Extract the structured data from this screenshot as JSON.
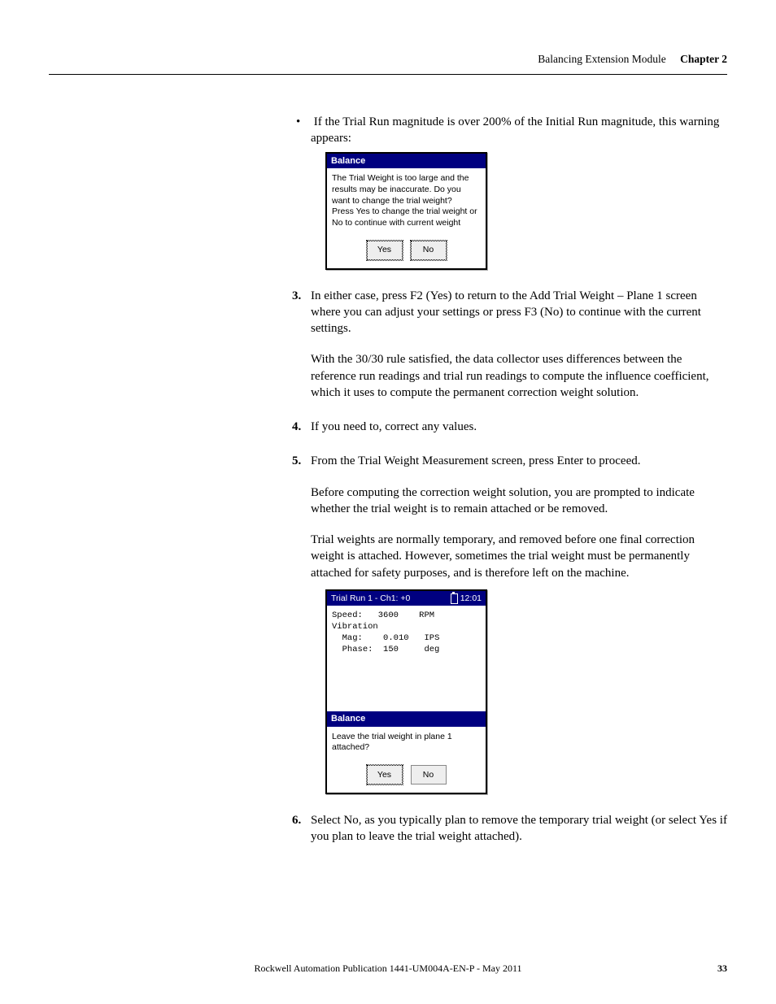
{
  "header": {
    "section_title": "Balancing Extension Module",
    "chapter_label": "Chapter 2"
  },
  "bullet1": "If the Trial Run magnitude is over 200% of the Initial Run magnitude, this warning appears:",
  "dialog1": {
    "title": "Balance",
    "body": "The Trial Weight is too large and the results may be inaccurate. Do you want to change the trial weight?\nPress Yes to change the trial weight or No to continue with current weight",
    "btn_yes": "Yes",
    "btn_no": "No"
  },
  "step3_num": "3.",
  "step3": "In either case, press F2 (Yes) to return to the Add Trial Weight – Plane 1 screen where you can adjust your settings or press F3 (No) to continue with the current settings.",
  "para3a": "With the 30/30 rule satisfied, the data collector uses differences between the reference run readings and trial run readings to compute the influence coefficient, which it uses to compute the permanent correction weight solution.",
  "step4_num": "4.",
  "step4": "If you need to, correct any values.",
  "step5_num": "5.",
  "step5": "From the Trial Weight Measurement screen, press Enter to proceed.",
  "para5a": "Before computing the correction weight solution, you are prompted to indicate whether the trial weight is to remain attached or be removed.",
  "para5b": "Trial weights are normally temporary, and removed before one final correction weight is attached. However, sometimes the trial weight must be permanently attached for safety purposes, and is therefore left on the machine.",
  "screen2": {
    "title_left": "Trial Run 1 - Ch1: +0",
    "title_time": "12:01",
    "rows": {
      "speed_lbl": "Speed:",
      "speed_val": "3600",
      "speed_unit": "RPM",
      "vib_lbl": "Vibration",
      "mag_lbl": "Mag:",
      "mag_val": "0.010",
      "mag_unit": "IPS",
      "phase_lbl": "Phase:",
      "phase_val": "150",
      "phase_unit": "deg"
    }
  },
  "dialog2": {
    "title": "Balance",
    "body": "Leave the trial weight in plane 1 attached?",
    "btn_yes": "Yes",
    "btn_no": "No"
  },
  "step6_num": "6.",
  "step6": "Select No, as you typically plan to remove the temporary trial weight (or select Yes if you plan to leave the trial weight attached).",
  "footer": {
    "publication": "Rockwell Automation Publication 1441-UM004A-EN-P - May 2011",
    "page": "33"
  }
}
